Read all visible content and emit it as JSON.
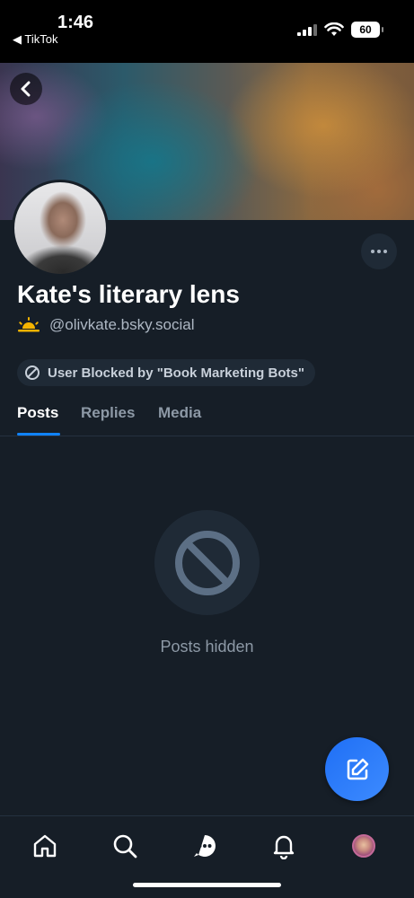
{
  "status_bar": {
    "time": "1:46",
    "back_app": "◀ TikTok",
    "battery": "60"
  },
  "profile": {
    "display_name": "Kate's literary lens",
    "handle": "@olivkate.bsky.social",
    "handle_emoji": "sunrise-icon",
    "label_badge": "User Blocked by \"Book Marketing Bots\""
  },
  "tabs": [
    {
      "label": "Posts",
      "active": true
    },
    {
      "label": "Replies",
      "active": false
    },
    {
      "label": "Media",
      "active": false
    }
  ],
  "feed": {
    "empty_message": "Posts hidden"
  },
  "nav": {
    "items": [
      "home-icon",
      "search-icon",
      "chat-icon",
      "bell-icon",
      "profile-avatar"
    ]
  },
  "colors": {
    "background": "#161e27",
    "accent": "#1083fe",
    "fab": "#1f6ff5"
  }
}
